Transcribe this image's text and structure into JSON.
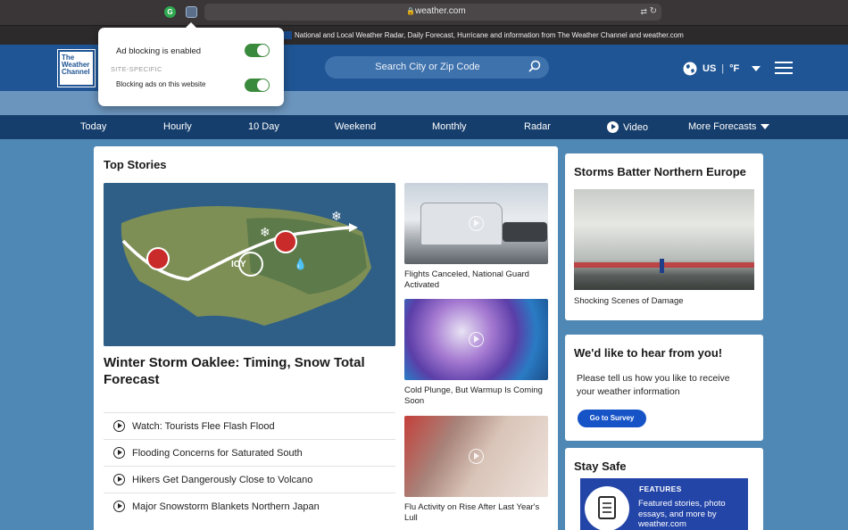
{
  "browser": {
    "url": "weather.com",
    "tab_title": "National and Local Weather Radar, Daily Forecast, Hurricane and information from The Weather Channel and weather.com"
  },
  "adblock_popover": {
    "main_label": "Ad blocking is enabled",
    "main_toggle_on": true,
    "section_label": "SITE-SPECIFIC",
    "site_label": "Blocking ads on this website",
    "site_toggle_on": true
  },
  "header": {
    "logo_lines": [
      "The",
      "Weather",
      "Channel"
    ],
    "search_placeholder": "Search City or Zip Code",
    "locale": "US",
    "unit": "°F"
  },
  "nav": {
    "items": [
      "Today",
      "Hourly",
      "10 Day",
      "Weekend",
      "Monthly",
      "Radar",
      "Video",
      "More Forecasts"
    ]
  },
  "top_stories": {
    "heading": "Top Stories",
    "hero_title": "Winter Storm Oaklee: Timing, Snow Total Forecast",
    "hero_map_label": "ICY",
    "list": [
      "Watch: Tourists Flee Flash Flood",
      "Flooding Concerns for Saturated South",
      "Hikers Get Dangerously Close to Volcano",
      "Major Snowstorm Blankets Northern Japan"
    ],
    "thumbs": [
      "Flights Canceled, National Guard Activated",
      "Cold Plunge, But Warmup Is Coming Soon",
      "Flu Activity on Rise After Last Year's Lull"
    ]
  },
  "storms_card": {
    "title": "Storms Batter Northern Europe",
    "caption": "Shocking Scenes of Damage"
  },
  "survey_card": {
    "title": "We'd like to hear from you!",
    "text": "Please tell us how you like to receive your weather information",
    "button": "Go to Survey"
  },
  "safe_card": {
    "title": "Stay Safe",
    "features_label": "FEATURES",
    "features_text": "Featured stories, photo essays, and more by weather.com"
  },
  "colors": {
    "header_blue": "#1f5594",
    "nav_blue": "#163e6c",
    "toggle_green": "#3a8a3e",
    "button_blue": "#1553c7"
  }
}
